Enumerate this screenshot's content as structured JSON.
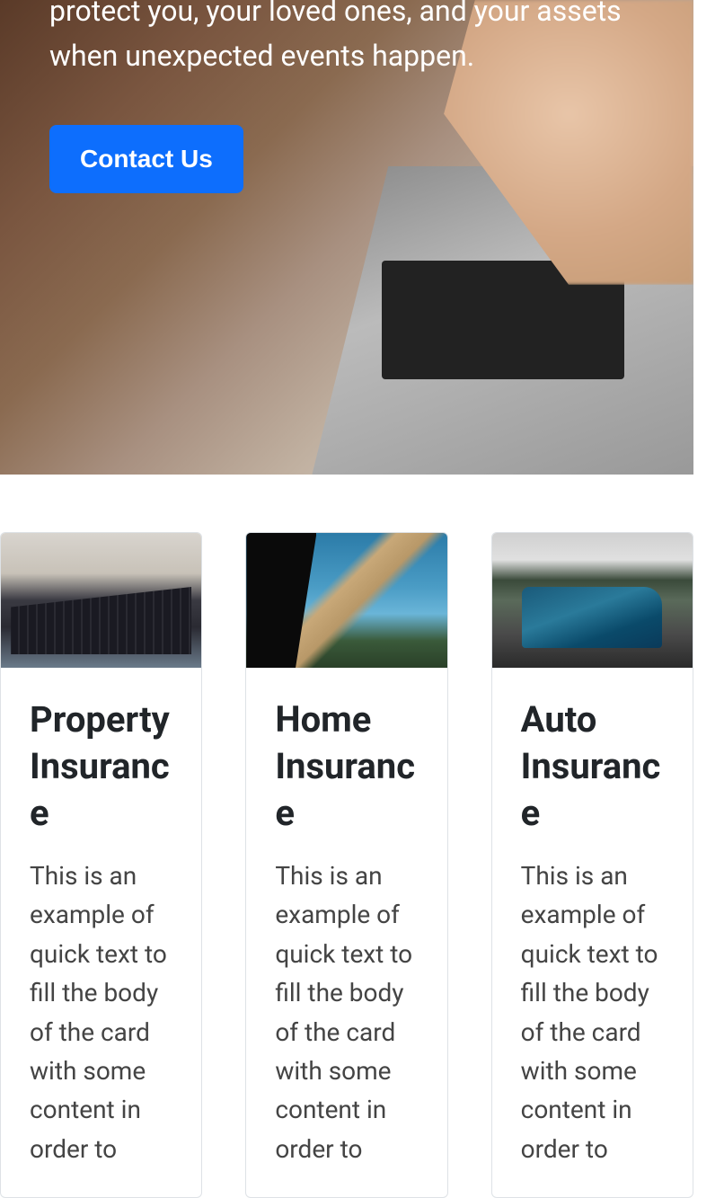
{
  "hero": {
    "description": "protect you, your loved ones, and your assets when unexpected events happen.",
    "cta_label": "Contact Us"
  },
  "cards": [
    {
      "title": "Property Insurance",
      "text": "This is an example of quick text to fill the body of the card with some content in order to"
    },
    {
      "title": "Home Insurance",
      "text": "This is an example of quick text to fill the body of the card with some content in order to"
    },
    {
      "title": "Auto Insurance",
      "text": "This is an example of quick text to fill the body of the card with some content in order to"
    }
  ]
}
